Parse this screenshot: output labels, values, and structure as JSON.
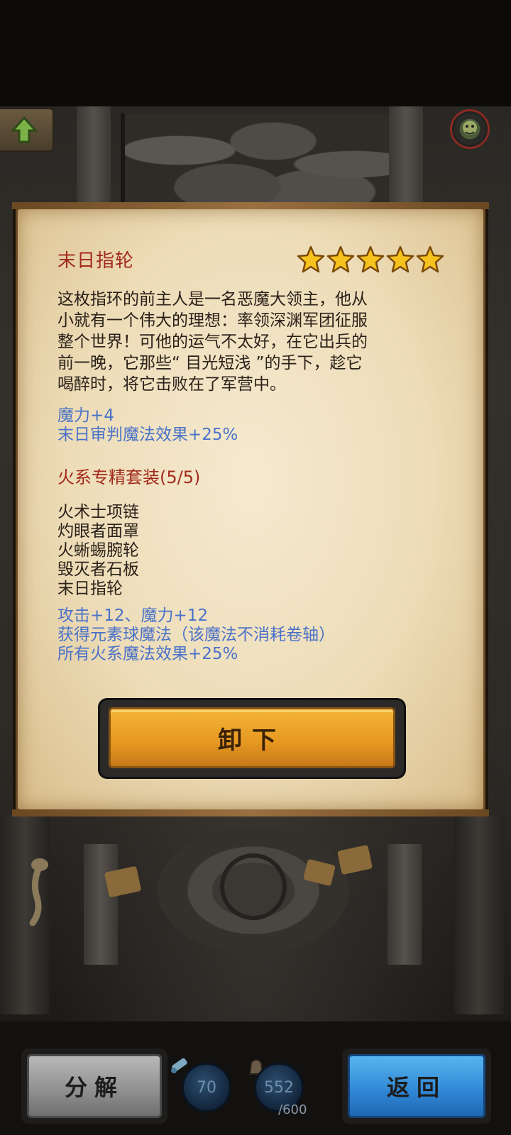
{
  "item": {
    "name": "末日指轮",
    "rating_stars": 5,
    "description_lines": [
      "这枚指环的前主人是一名恶魔大领主，他从",
      "小就有一个伟大的理想：率领深渊军团征服",
      "整个世界！可他的运气不太好，在它出兵的",
      "前一晚，它那些“ 目光短浅 ”的手下，趁它",
      "喝醉时，将它击败在了军营中。"
    ],
    "base_stats": [
      "魔力+4",
      "末日审判魔法效果+25%"
    ]
  },
  "set": {
    "title": "火系专精套装(5/5)",
    "items": [
      "火术士项链",
      "灼眼者面罩",
      "火蜥蜴腕轮",
      "毁灭者石板",
      "末日指轮"
    ],
    "bonuses": [
      "攻击+12、魔力+12",
      "获得元素球魔法（该魔法不消耗卷轴）",
      "所有火系魔法效果+25%"
    ]
  },
  "actions": {
    "unequip_label": "卸下",
    "decompose_label": "分解",
    "back_label": "返回"
  },
  "resources": {
    "scrolls": "70",
    "storage_used": "552",
    "storage_capacity": "/600"
  },
  "icons": {
    "up": "up-arrow-icon",
    "avatar": "hero-avatar-icon",
    "star": "star-icon",
    "scroll": "scroll-icon",
    "storage": "bag-icon"
  },
  "colors": {
    "item_title": "#a22a1c",
    "stat_text": "#4a72c8",
    "body_text": "#2a211a",
    "unequip_button": "#e89a22",
    "back_button": "#2f86d4",
    "decompose_button": "#8e8e8e"
  }
}
